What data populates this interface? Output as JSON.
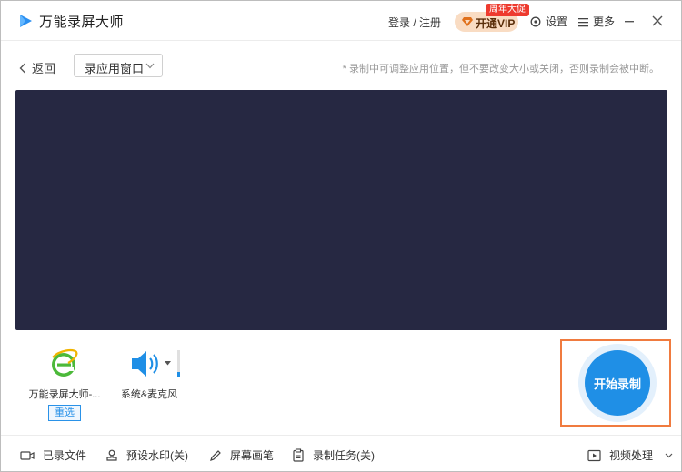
{
  "app": {
    "title": "万能录屏大师"
  },
  "header": {
    "login": "登录 / 注册",
    "vip_label": "开通VIP",
    "vip_badge": "周年大促",
    "settings": "设置",
    "more": "更多"
  },
  "toolbar": {
    "back": "返回",
    "mode": "录应用窗口",
    "hint": "* 录制中可调整应用位置，但不要改变大小或关闭，否则录制会被中断。"
  },
  "sources": {
    "app_name": "万能录屏大师-...",
    "reselect": "重选",
    "audio": "系统&麦克风"
  },
  "record": {
    "label": "开始录制"
  },
  "bottom": {
    "files": "已录文件",
    "watermark": "预设水印(关)",
    "pen": "屏幕画笔",
    "tasks": "录制任务(关)",
    "video": "视频处理"
  },
  "colors": {
    "accent": "#1f8fe6",
    "preview_bg": "#262842",
    "highlight": "#f07b3f"
  }
}
